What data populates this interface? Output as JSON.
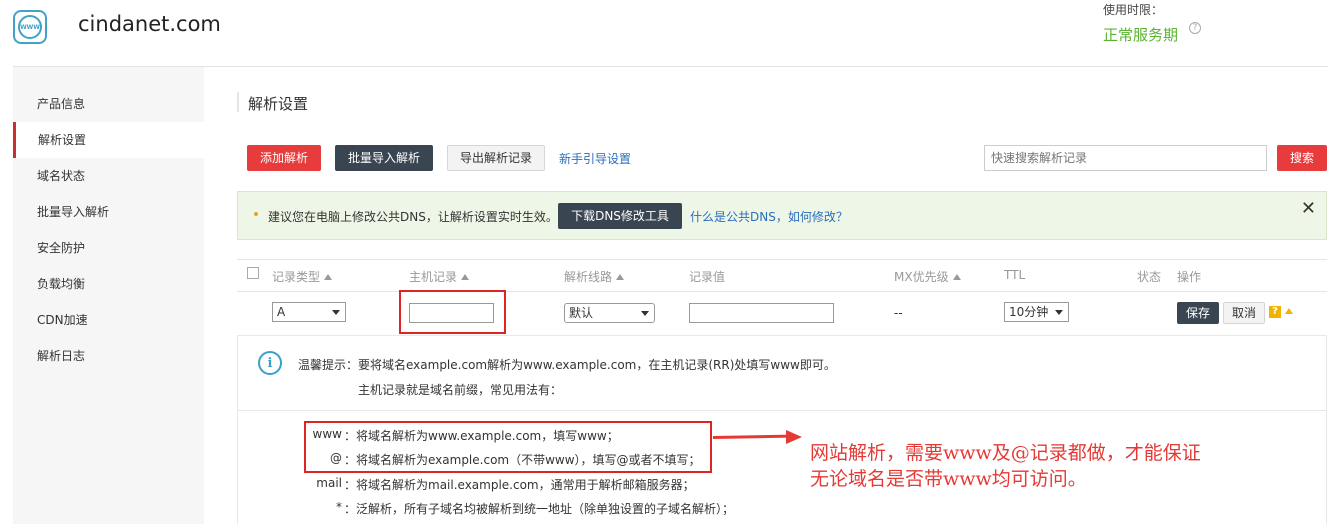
{
  "header": {
    "logo_text": "WWW",
    "site_name": "cindanet.com",
    "usage_label": "使用时限：",
    "usage_status": "正常服务期",
    "help_icon": "question-circle-icon"
  },
  "sidebar": {
    "items": [
      {
        "label": "产品信息"
      },
      {
        "label": "解析设置"
      },
      {
        "label": "域名状态"
      },
      {
        "label": "批量导入解析"
      },
      {
        "label": "安全防护"
      },
      {
        "label": "负载均衡"
      },
      {
        "label": "CDN加速"
      },
      {
        "label": "解析日志"
      }
    ],
    "active_index": 1
  },
  "page": {
    "title": "解析设置"
  },
  "toolbar": {
    "add_label": "添加解析",
    "batch_import_label": "批量导入解析",
    "export_label": "导出解析记录",
    "guide_link": "新手引导设置",
    "search_placeholder": "快速搜索解析记录",
    "search_button": "搜索"
  },
  "notice": {
    "text": "建议您在电脑上修改公共DNS，让解析设置实时生效。",
    "download_button": "下载DNS修改工具",
    "link": "什么是公共DNS，如何修改？",
    "close_icon": "close-icon"
  },
  "table": {
    "headers": {
      "type": "记录类型",
      "host": "主机记录",
      "line": "解析线路",
      "value": "记录值",
      "mx": "MX优先级",
      "ttl": "TTL",
      "status": "状态",
      "action": "操作"
    },
    "row": {
      "type_value": "A",
      "host_value": "",
      "line_value": "默认",
      "record_value": "",
      "mx_value": "--",
      "ttl_value": "10分钟",
      "save_label": "保存",
      "cancel_label": "取消",
      "help_badge": "?"
    }
  },
  "tips": {
    "label": "温馨提示：",
    "line1": "要将域名example.com解析为www.example.com，在主机记录(RR)处填写www即可。",
    "line2": "主机记录就是域名前缀，常见用法有：",
    "examples": [
      {
        "prefix": "www",
        "desc": "：将域名解析为www.example.com，填写www；"
      },
      {
        "prefix": "@",
        "desc": "：将域名解析为example.com（不带www），填写@或者不填写；"
      },
      {
        "prefix": "mail",
        "desc": "：将域名解析为mail.example.com，通常用于解析邮箱服务器；"
      },
      {
        "prefix": "*",
        "desc": "：泛解析，所有子域名均被解析到统一地址（除单独设置的子域名解析）；"
      }
    ]
  },
  "annotation": {
    "line1": "网站解析，需要www及@记录都做，才能保证",
    "line2": "无论域名是否带www均可访问。",
    "color": "#e53935"
  }
}
